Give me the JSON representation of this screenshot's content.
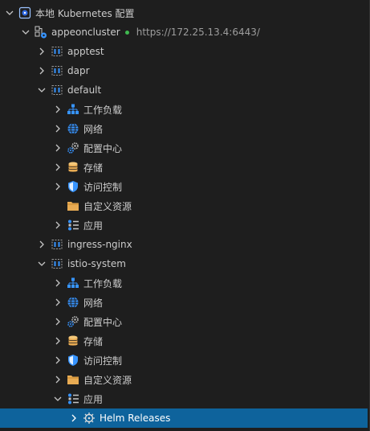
{
  "tree": {
    "root": {
      "label": "本地 Kubernetes 配置"
    },
    "cluster": {
      "label": "appeoncluster",
      "url": "https://172.25.13.4:6443/",
      "status_color": "#3fb950"
    },
    "namespaces": {
      "apptest": {
        "label": "apptest"
      },
      "dapr": {
        "label": "dapr"
      },
      "default": {
        "label": "default",
        "children": {
          "workloads": "工作负载",
          "network": "网络",
          "config": "配置中心",
          "storage": "存储",
          "access": "访问控制",
          "crd": "自定义资源",
          "apps": "应用"
        }
      },
      "ingress": {
        "label": "ingress-nginx"
      },
      "istio": {
        "label": "istio-system",
        "children": {
          "workloads": "工作负载",
          "network": "网络",
          "config": "配置中心",
          "storage": "存储",
          "access": "访问控制",
          "crd": "自定义资源",
          "apps": "应用",
          "helm": "Helm Releases"
        }
      }
    }
  },
  "colors": {
    "background": "#1e1e1e",
    "text": "#cccccc",
    "selected": "#0e639c",
    "accent_blue": "#3794ff",
    "folder_yellow": "#e8ab53",
    "k8s_blue": "#326ce5"
  },
  "icons": {
    "expanded": "chevron-down-icon",
    "collapsed": "chevron-right-icon",
    "root": "kubernetes-icon",
    "cluster": "cluster-icon",
    "namespace": "namespace-icon",
    "workloads": "workloads-icon",
    "network": "globe-icon",
    "config": "gears-icon",
    "storage": "database-icon",
    "access": "shield-icon",
    "crd": "folder-icon",
    "apps": "apps-icon",
    "helm": "helm-icon"
  }
}
